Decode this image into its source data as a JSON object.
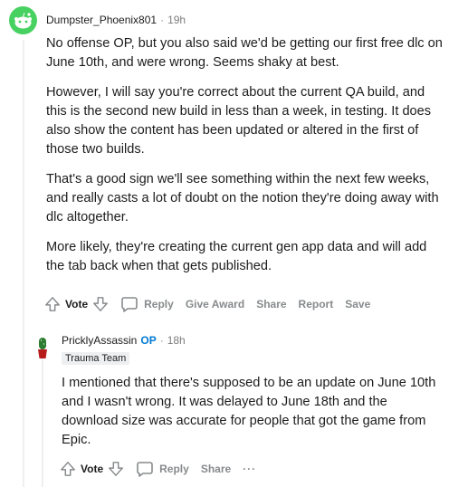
{
  "comment": {
    "author": "Dumpster_Phoenix801",
    "time": "19h",
    "paragraphs": [
      "No offense OP, but you also said we'd be getting our first free dlc on June 10th, and were wrong. Seems shaky at best.",
      "However, I will say you're correct about the current QA build, and this is the second new build in less than a week, in testing. It does also show the content has been updated or altered in the first of those two builds.",
      "That's a good sign we'll see something within the next few weeks, and really casts a lot of doubt on the notion they're doing away with dlc altogether.",
      "More likely, they're creating the current gen app data and will add the tab back when that gets published."
    ],
    "actions": {
      "vote": "Vote",
      "reply": "Reply",
      "give_award": "Give Award",
      "share": "Share",
      "report": "Report",
      "save": "Save"
    }
  },
  "reply": {
    "author": "PricklyAssassin",
    "op_badge": "OP",
    "time": "18h",
    "flair": "Trauma Team",
    "paragraphs": [
      "I mentioned that there's supposed to be an update on June 10th and I wasn't wrong. It was delayed to June 18th and the download size was accurate for people that got the game from Epic."
    ],
    "actions": {
      "vote": "Vote",
      "reply": "Reply",
      "share": "Share",
      "more": "···"
    }
  },
  "colors": {
    "avatar_green": "#46d160",
    "op_blue": "#0079d3",
    "meta_gray": "#878a8c"
  }
}
